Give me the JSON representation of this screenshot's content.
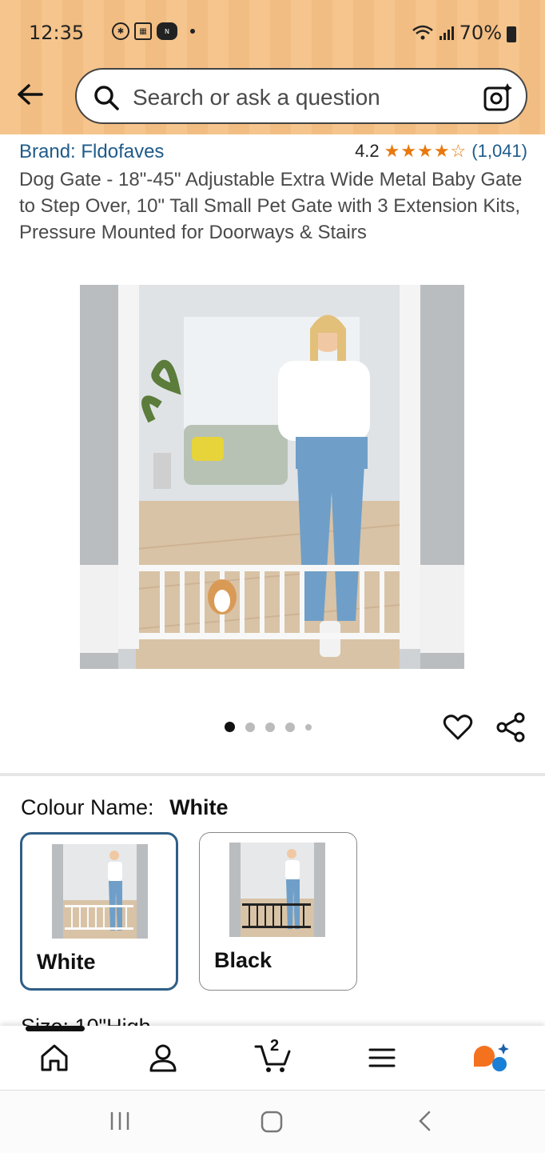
{
  "status_bar": {
    "time": "12:35",
    "battery": "70%"
  },
  "search": {
    "placeholder": "Search or ask a question"
  },
  "product": {
    "brand": "Brand: Fldofaves",
    "rating": "4.2",
    "stars": "★★★★☆",
    "review_count": "(1,041)",
    "title": "Dog Gate - 18\"-45\" Adjustable Extra Wide Metal Baby Gate to Step Over, 10\" Tall Small Pet Gate with 3 Extension Kits, Pressure Mounted for Doorways & Stairs"
  },
  "gallery": {
    "image_count": 5,
    "active_index": 0
  },
  "variations": {
    "colour_label": "Colour Name:",
    "selected_colour": "White",
    "options": [
      {
        "label": "White",
        "selected": true
      },
      {
        "label": "Black",
        "selected": false
      }
    ],
    "next_section_peek": "Size: 10\"High"
  },
  "bottom_nav": {
    "cart_count": "2"
  },
  "colors": {
    "accent_blue": "#1e5b8a",
    "star_orange": "#e8790d",
    "header_bg": "#f5c58d",
    "rufus_orange": "#f4711e"
  },
  "icons": [
    "back-arrow-icon",
    "search-icon",
    "camera-sparkle-icon",
    "heart-icon",
    "share-icon",
    "home-icon",
    "account-icon",
    "cart-icon",
    "menu-icon",
    "rufus-icon"
  ]
}
